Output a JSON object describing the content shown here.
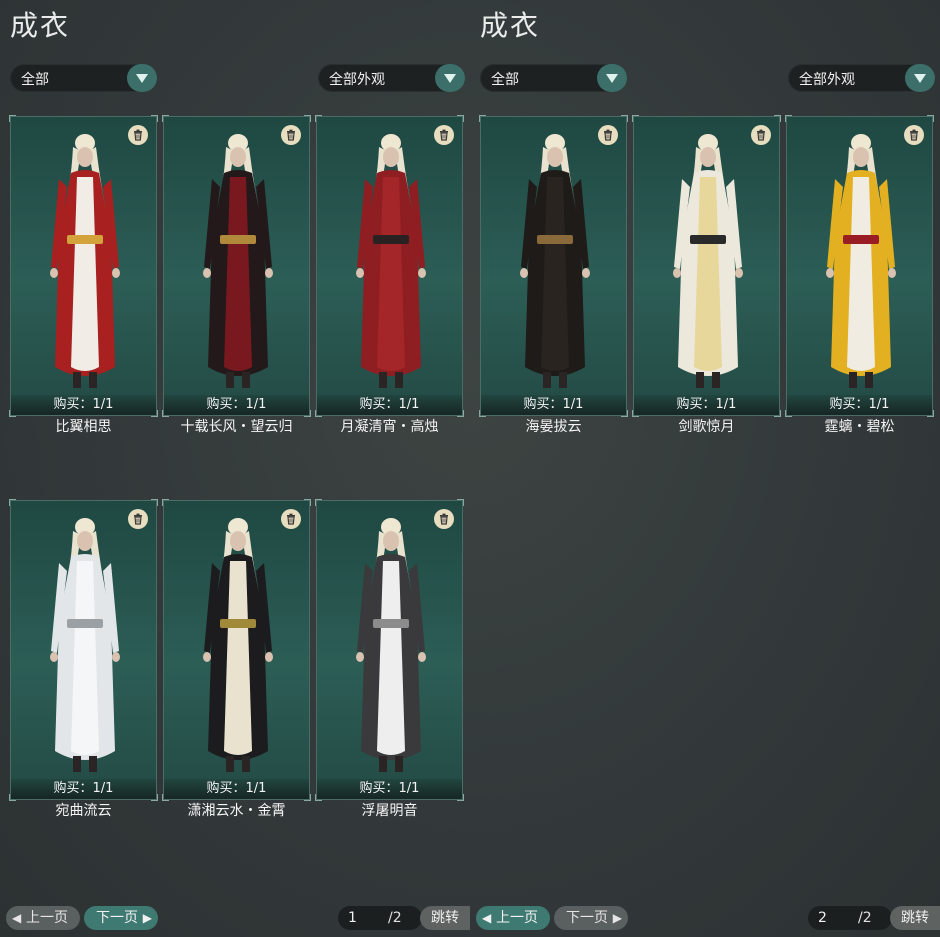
{
  "colors": {
    "accent": "#3f7a72",
    "card_bg": "#2c5e56",
    "trash_bg": "#e7ddbf"
  },
  "left": {
    "title": "成衣",
    "filter1": {
      "label": "全部"
    },
    "filter2": {
      "label": "全部外观"
    },
    "items": [
      {
        "name": "比翼相思",
        "buy": "购买：1/1",
        "robe": "#a8201f",
        "inner": "#f1ece6",
        "trim": "#d4a23a"
      },
      {
        "name": "十载长风・望云归",
        "buy": "购买：1/1",
        "robe": "#24191a",
        "inner": "#7a1820",
        "trim": "#b0893a"
      },
      {
        "name": "月凝清宵・高烛",
        "buy": "购买：1/1",
        "robe": "#8e1e22",
        "inner": "#a52628",
        "trim": "#2a2222"
      },
      {
        "name": "宛曲流云",
        "buy": "购买：1/1",
        "robe": "#e3e6e8",
        "inner": "#f5f6f7",
        "trim": "#9aa0a4"
      },
      {
        "name": "潇湘云水・金霄",
        "buy": "购买：1/1",
        "robe": "#1c1c1e",
        "inner": "#e9e2cf",
        "trim": "#a08a3a"
      },
      {
        "name": "浮屠明音",
        "buy": "购买：1/1",
        "robe": "#3a3a3c",
        "inner": "#eeeeee",
        "trim": "#8c8c8c"
      }
    ],
    "prev_label": "上一页",
    "next_label": "下一页",
    "page_current": "1",
    "page_total": "/2",
    "jump_label": "跳转"
  },
  "right": {
    "title": "成衣",
    "filter1": {
      "label": "全部"
    },
    "filter2": {
      "label": "全部外观"
    },
    "items": [
      {
        "name": "海晏拔云",
        "buy": "购买：1/1",
        "robe": "#1e1b18",
        "inner": "#2a2420",
        "trim": "#8a6a3a"
      },
      {
        "name": "剑歌惊月",
        "buy": "购买：1/1",
        "robe": "#ece8dc",
        "inner": "#e8d79a",
        "trim": "#2a2a2a"
      },
      {
        "name": "霆螭・碧松",
        "buy": "购买：1/1",
        "robe": "#e2b020",
        "inner": "#f0ece2",
        "trim": "#9a1d24"
      }
    ],
    "prev_label": "上一页",
    "next_label": "下一页",
    "page_current": "2",
    "page_total": "/2",
    "jump_label": "跳转"
  }
}
